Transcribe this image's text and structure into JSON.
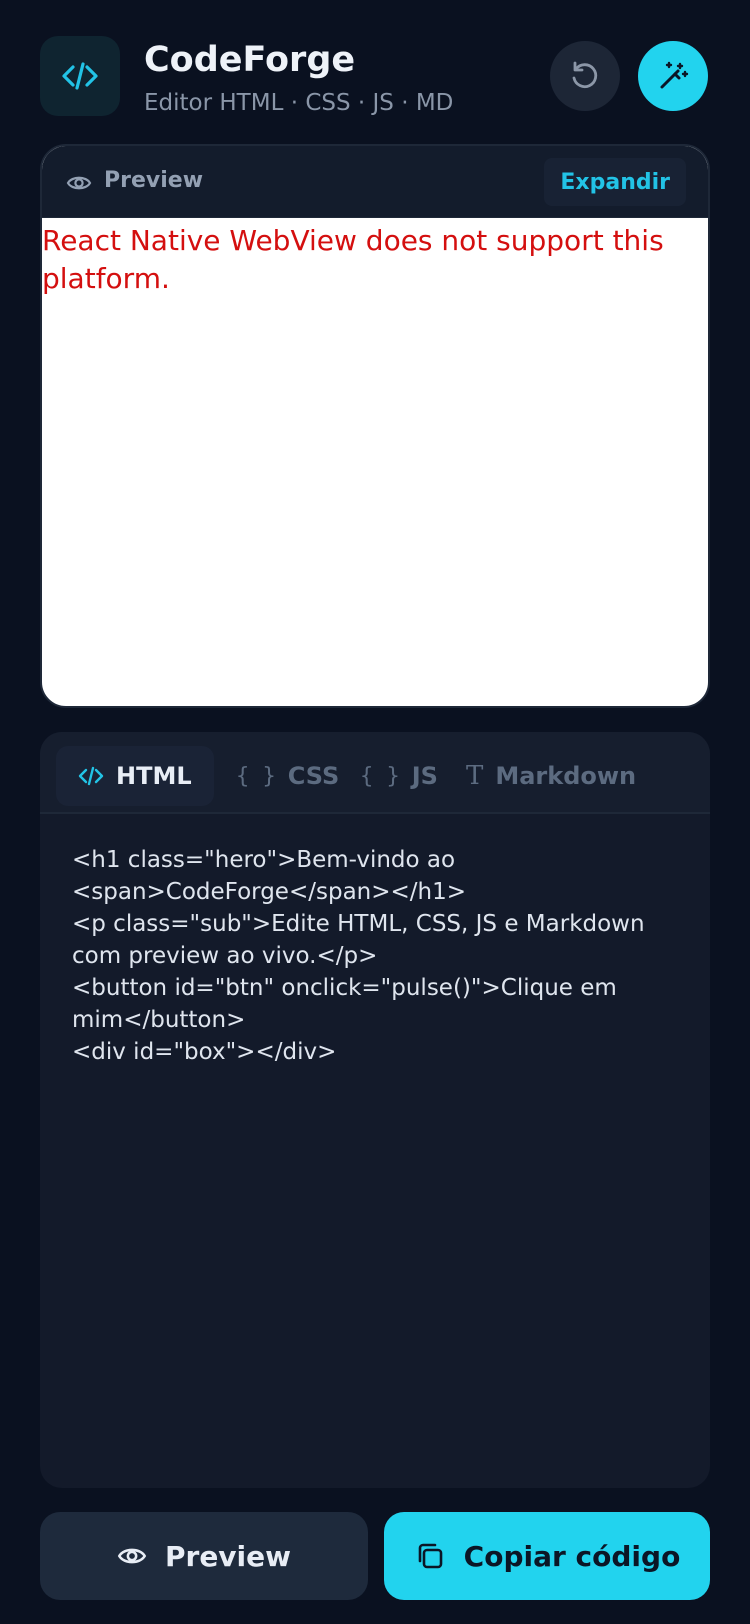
{
  "header": {
    "title": "CodeForge",
    "subtitle": "Editor HTML · CSS · JS · MD",
    "logo_icon": "code-brackets-icon",
    "reset_icon": "rotate-ccw-icon",
    "magic_icon": "magic-wand-icon"
  },
  "preview": {
    "title": "Preview",
    "expand_label": "Expandir",
    "message": "React Native WebView does not support this platform."
  },
  "editor": {
    "tabs": [
      {
        "label": "HTML",
        "glyph": "</>",
        "active": true
      },
      {
        "label": "CSS",
        "glyph": "{ }",
        "active": false
      },
      {
        "label": "JS",
        "glyph": "{ }",
        "active": false
      },
      {
        "label": "Markdown",
        "glyph": "T",
        "active": false
      }
    ],
    "code": "<h1 class=\"hero\">Bem-vindo ao\n<span>CodeForge</span></h1>\n<p class=\"sub\">Edite HTML, CSS, JS e Markdown com preview ao vivo.</p>\n<button id=\"btn\" onclick=\"pulse()\">Clique em mim</button>\n<div id=\"box\"></div>"
  },
  "actions": {
    "preview_label": "Preview",
    "copy_label": "Copiar código"
  },
  "colors": {
    "background": "#0a1120",
    "accent": "#22d3ee",
    "error_text": "#d40f0f"
  }
}
